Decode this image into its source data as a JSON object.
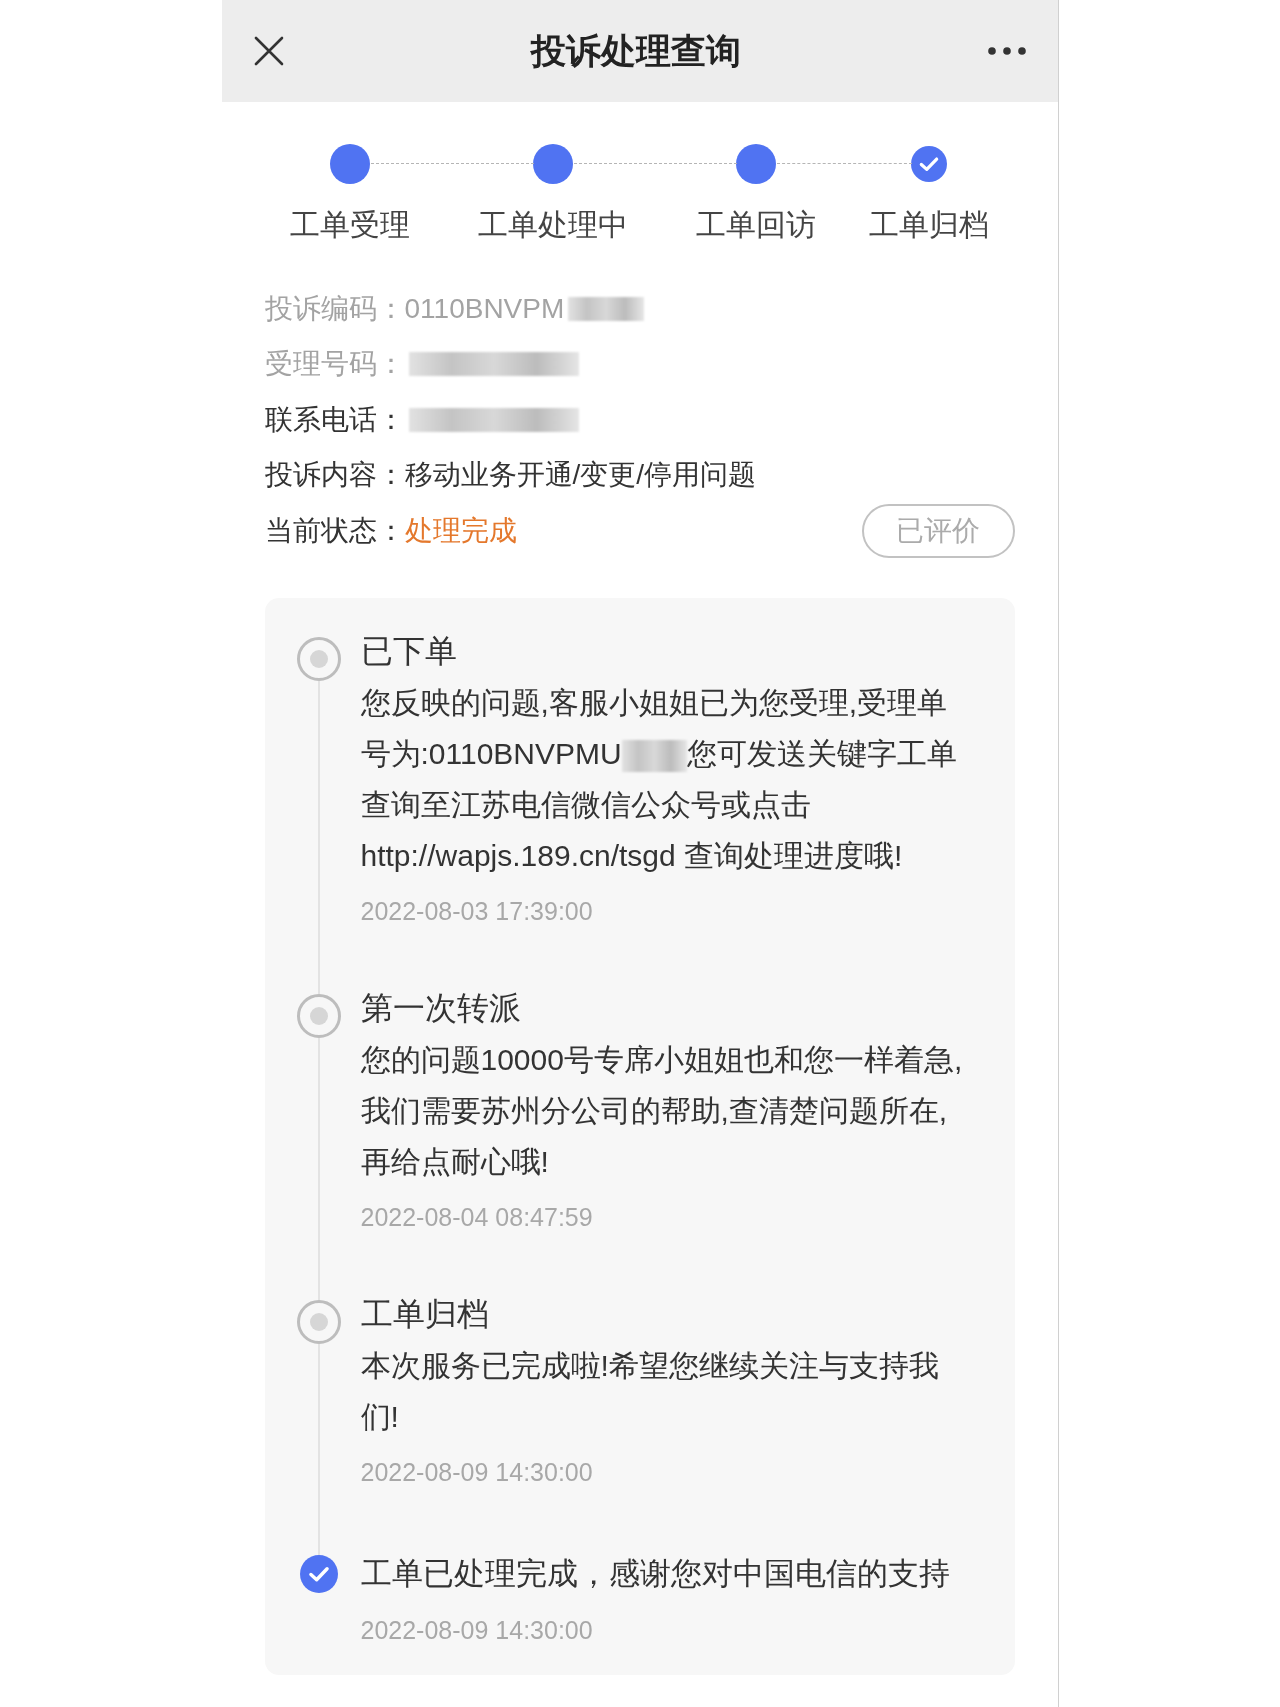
{
  "header": {
    "title": "投诉处理查询"
  },
  "steps": [
    {
      "label": "工单受理",
      "done": true,
      "current": false
    },
    {
      "label": "工单处理中",
      "done": true,
      "current": false
    },
    {
      "label": "工单回访",
      "done": true,
      "current": false
    },
    {
      "label": "工单归档",
      "done": true,
      "current": true
    }
  ],
  "details": [
    {
      "label": "投诉编码：",
      "value": "0110BNVPM",
      "redacted": true,
      "muted": true,
      "kind": "plain"
    },
    {
      "label": "受理号码：",
      "redacted": true,
      "muted": true,
      "kind": "plain"
    },
    {
      "label": "联系电话：",
      "redacted": true,
      "muted": false,
      "kind": "plain"
    },
    {
      "label": "投诉内容：",
      "value": "移动业务开通/变更/停用问题",
      "muted": false,
      "kind": "plain"
    },
    {
      "label": "当前状态：",
      "value": "处理完成",
      "muted": false,
      "kind": "status"
    }
  ],
  "rate_button": {
    "label": "已评价",
    "disabled": true
  },
  "timeline": [
    {
      "title": "已下单",
      "completed": false,
      "body": [
        {
          "kind": "text",
          "text": "您反映的问题,客服小姐姐已为您受理,受理单号为:0110BNVPMU"
        },
        {
          "kind": "redacted"
        },
        {
          "kind": "text",
          "text": "您可发送关键字工单查询至江苏电信微信公众号或点击http://wapjs.189.cn/tsgd 查询处理进度哦!"
        }
      ],
      "time": "2022-08-03 17:39:00"
    },
    {
      "title": "第一次转派",
      "completed": false,
      "body": [
        {
          "kind": "text",
          "text": "您的问题10000号专席小姐姐也和您一样着急,我们需要苏州分公司的帮助,查清楚问题所在,再给点耐心哦!"
        }
      ],
      "time": "2022-08-04 08:47:59"
    },
    {
      "title": "工单归档",
      "completed": false,
      "body": [
        {
          "kind": "text",
          "text": "本次服务已完成啦!希望您继续关注与支持我们!"
        }
      ],
      "time": "2022-08-09 14:30:00"
    },
    {
      "title": "工单已处理完成，感谢您对中国电信的支持",
      "completed": true,
      "time": "2022-08-09 14:30:00"
    }
  ]
}
